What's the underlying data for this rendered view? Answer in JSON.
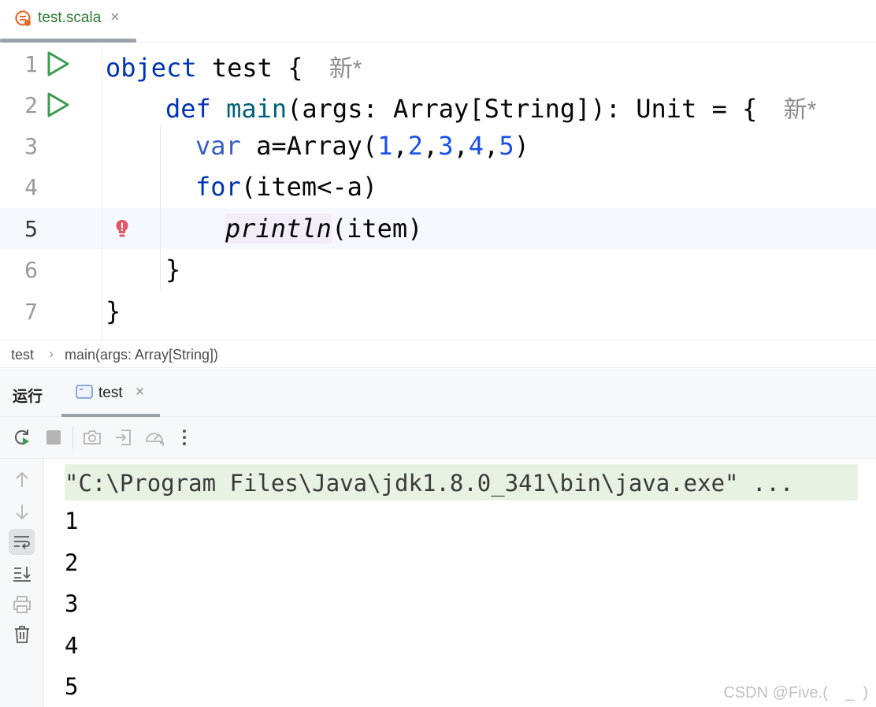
{
  "editor_tab": {
    "label": "test.scala",
    "close": "×"
  },
  "code": {
    "lines": [
      {
        "num": "1",
        "parts": [
          "object",
          " test { "
        ],
        "hint": "新*"
      },
      {
        "num": "2",
        "parts": [
          "def",
          " ",
          "main",
          "(args: Array[String]): Unit = { "
        ],
        "hint": "新*"
      },
      {
        "num": "3",
        "parts": [
          "var",
          " a=Array(",
          "1",
          ",",
          "2",
          ",",
          "3",
          ",",
          "4",
          ",",
          "5",
          ")"
        ]
      },
      {
        "num": "4",
        "parts": [
          "for",
          "(item<-a)"
        ]
      },
      {
        "num": "5",
        "parts": [
          "println",
          "(item)"
        ]
      },
      {
        "num": "6",
        "parts": [
          "}"
        ]
      },
      {
        "num": "7",
        "parts": [
          "}"
        ]
      }
    ]
  },
  "breadcrumb": {
    "items": [
      "test",
      "main(args: Array[String])"
    ],
    "sep": "›"
  },
  "run_panel": {
    "title": "运行",
    "tab_label": "test",
    "tab_close": "×"
  },
  "console": {
    "command": "\"C:\\Program Files\\Java\\jdk1.8.0_341\\bin\\java.exe\" ...",
    "output": [
      "1",
      "2",
      "3",
      "4",
      "5"
    ]
  },
  "watermark": "CSDN @Five.(    _  )",
  "colors": {
    "keyword": "#0033b3",
    "function": "#00627a",
    "number": "#1750eb",
    "run_green": "#3d9a50",
    "error_red": "#e55765"
  }
}
